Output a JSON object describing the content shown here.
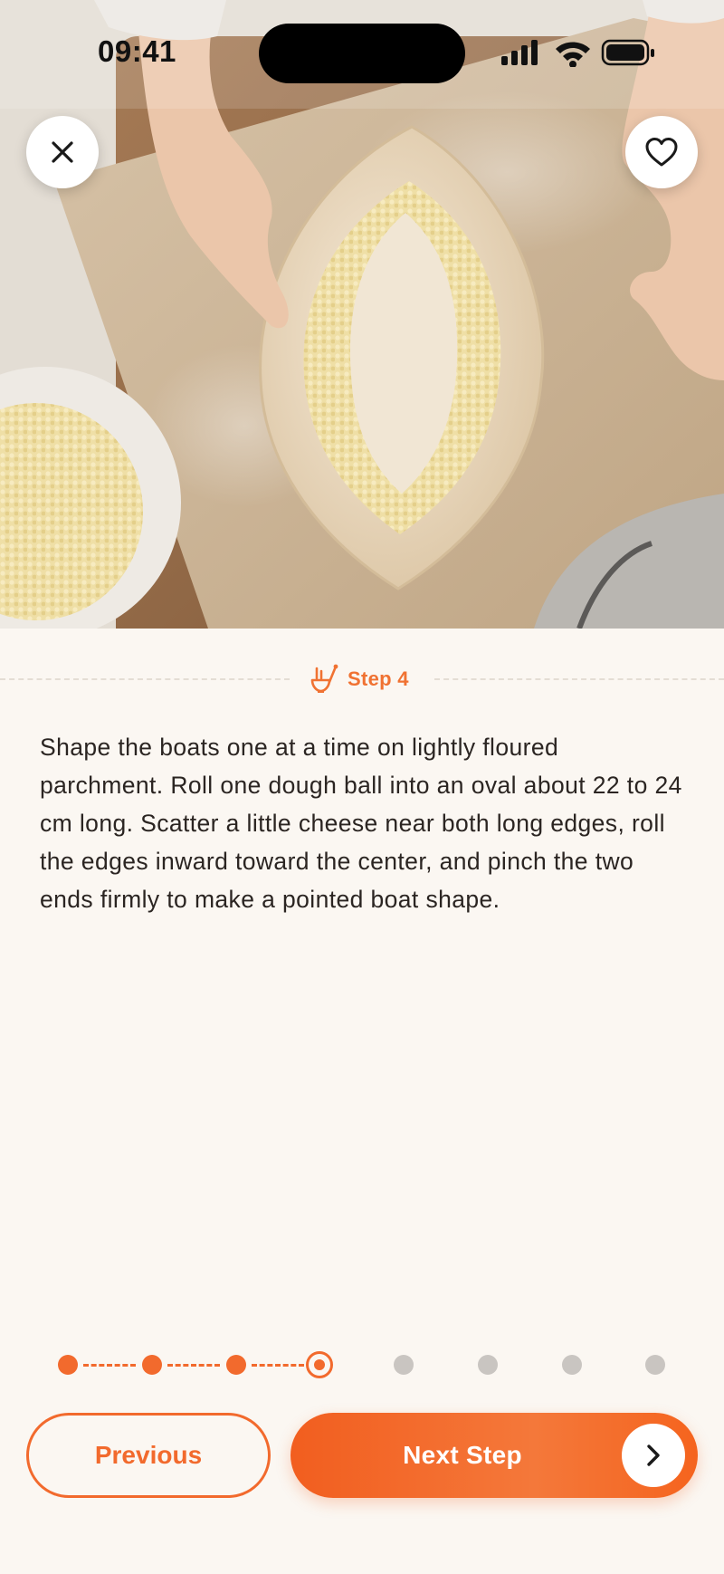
{
  "status_bar": {
    "time": "09:41"
  },
  "hero": {
    "image_alt": "Hands shaping a dough boat filled with grated cheese on floured parchment",
    "buttons": {
      "close_icon": "close-icon",
      "favorite_icon": "heart-icon"
    }
  },
  "step": {
    "icon": "ladle-bowl-icon",
    "label": "Step 4",
    "instruction": "Shape the boats one at a time on lightly floured parchment. Roll one dough ball into an oval about 22 to 24 cm long. Scatter a little cheese near both long edges, roll the edges inward toward the center, and pinch the two ends firmly to make a pointed boat shape."
  },
  "progress": {
    "total_steps": 8,
    "current_step": 4
  },
  "actions": {
    "previous_label": "Previous",
    "next_label": "Next Step",
    "next_icon": "chevron-right-icon"
  },
  "colors": {
    "accent": "#F26A2D",
    "background": "#FBF7F2",
    "text": "#2B2522",
    "inactive_dot": "#C9C5C1"
  }
}
